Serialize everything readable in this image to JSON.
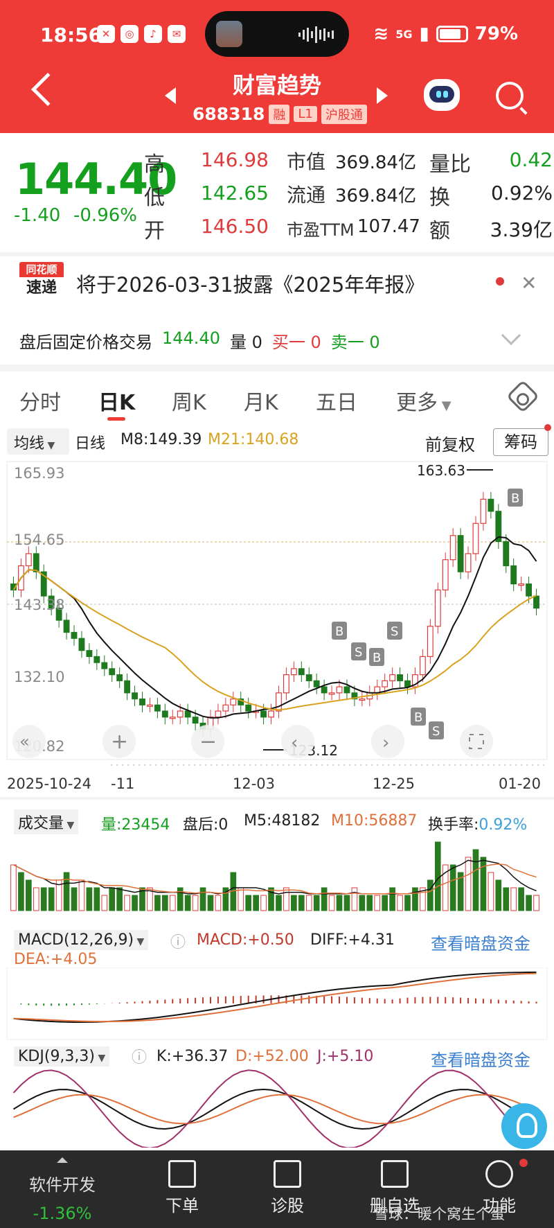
{
  "status_bar": {
    "time": "18:56",
    "network": "5G",
    "battery": "79%"
  },
  "header": {
    "title": "财富趋势",
    "code": "688318",
    "tags": [
      "融",
      "L1",
      "沪股通"
    ]
  },
  "quote": {
    "price": "144.40",
    "change": "-1.40",
    "change_pct": "-0.96%",
    "high_label": "高",
    "high": "146.98",
    "low_label": "低",
    "low": "142.65",
    "open_label": "开",
    "open": "146.50",
    "mcap_label": "市值",
    "mcap": "369.84亿",
    "float_label": "流通",
    "float": "369.84亿",
    "pe_label": "市盈TTM",
    "pe": "107.47",
    "vr_label": "量比",
    "vr": "0.42",
    "turn_label": "换",
    "turn": "0.92%",
    "amt_label": "额",
    "amt": "3.39亿"
  },
  "notice": {
    "badge_top": "同花顺",
    "badge_bottom": "速递",
    "text": "将于2026-03-31披露《2025年年报》"
  },
  "after_hours": {
    "label": "盘后固定价格交易",
    "price": "144.40",
    "vol": "量 0",
    "buy": "买一 0",
    "sell": "卖一 0"
  },
  "tabs": [
    "分时",
    "日K",
    "周K",
    "月K",
    "五日",
    "更多"
  ],
  "kline_header": {
    "ma_menu": "均线",
    "period": "日线",
    "m8": "M8:149.39",
    "m21": "M21:140.68",
    "adjust": "前复权",
    "chips": "筹码"
  },
  "kline": {
    "y_labels": [
      "165.93",
      "154.65",
      "143.38",
      "132.10",
      "120.82"
    ],
    "high_mark": "163.63",
    "low_mark": "123.12",
    "x_labels": [
      "2025-10-24",
      "-11",
      "12-03",
      "12-25",
      "01-20"
    ]
  },
  "volume": {
    "menu": "成交量",
    "vol": "量:23454",
    "after": "盘后:0",
    "m5": "M5:48182",
    "m10": "M10:56887",
    "turnover_label": "换手率:",
    "turnover": "0.92%"
  },
  "macd": {
    "menu": "MACD(12,26,9)",
    "macd": "MACD:+0.50",
    "diff": "DIFF:+4.31",
    "dea": "DEA:+4.05",
    "link": "查看暗盘资金"
  },
  "kdj": {
    "menu": "KDJ(9,3,3)",
    "k": "K:+36.37",
    "d": "D:+52.00",
    "j": "J:+5.10",
    "link": "查看暗盘资金"
  },
  "bottom_nav": {
    "stock_name": "软件开发",
    "stock_change": "-1.36%",
    "items": [
      "下单",
      "诊股",
      "删自选",
      "功能"
    ],
    "watermark": "雪球：暖个窝生个蛋"
  },
  "colors": {
    "up": "#e03a3a",
    "down": "#14a01e",
    "brand": "#ee3b38"
  }
}
